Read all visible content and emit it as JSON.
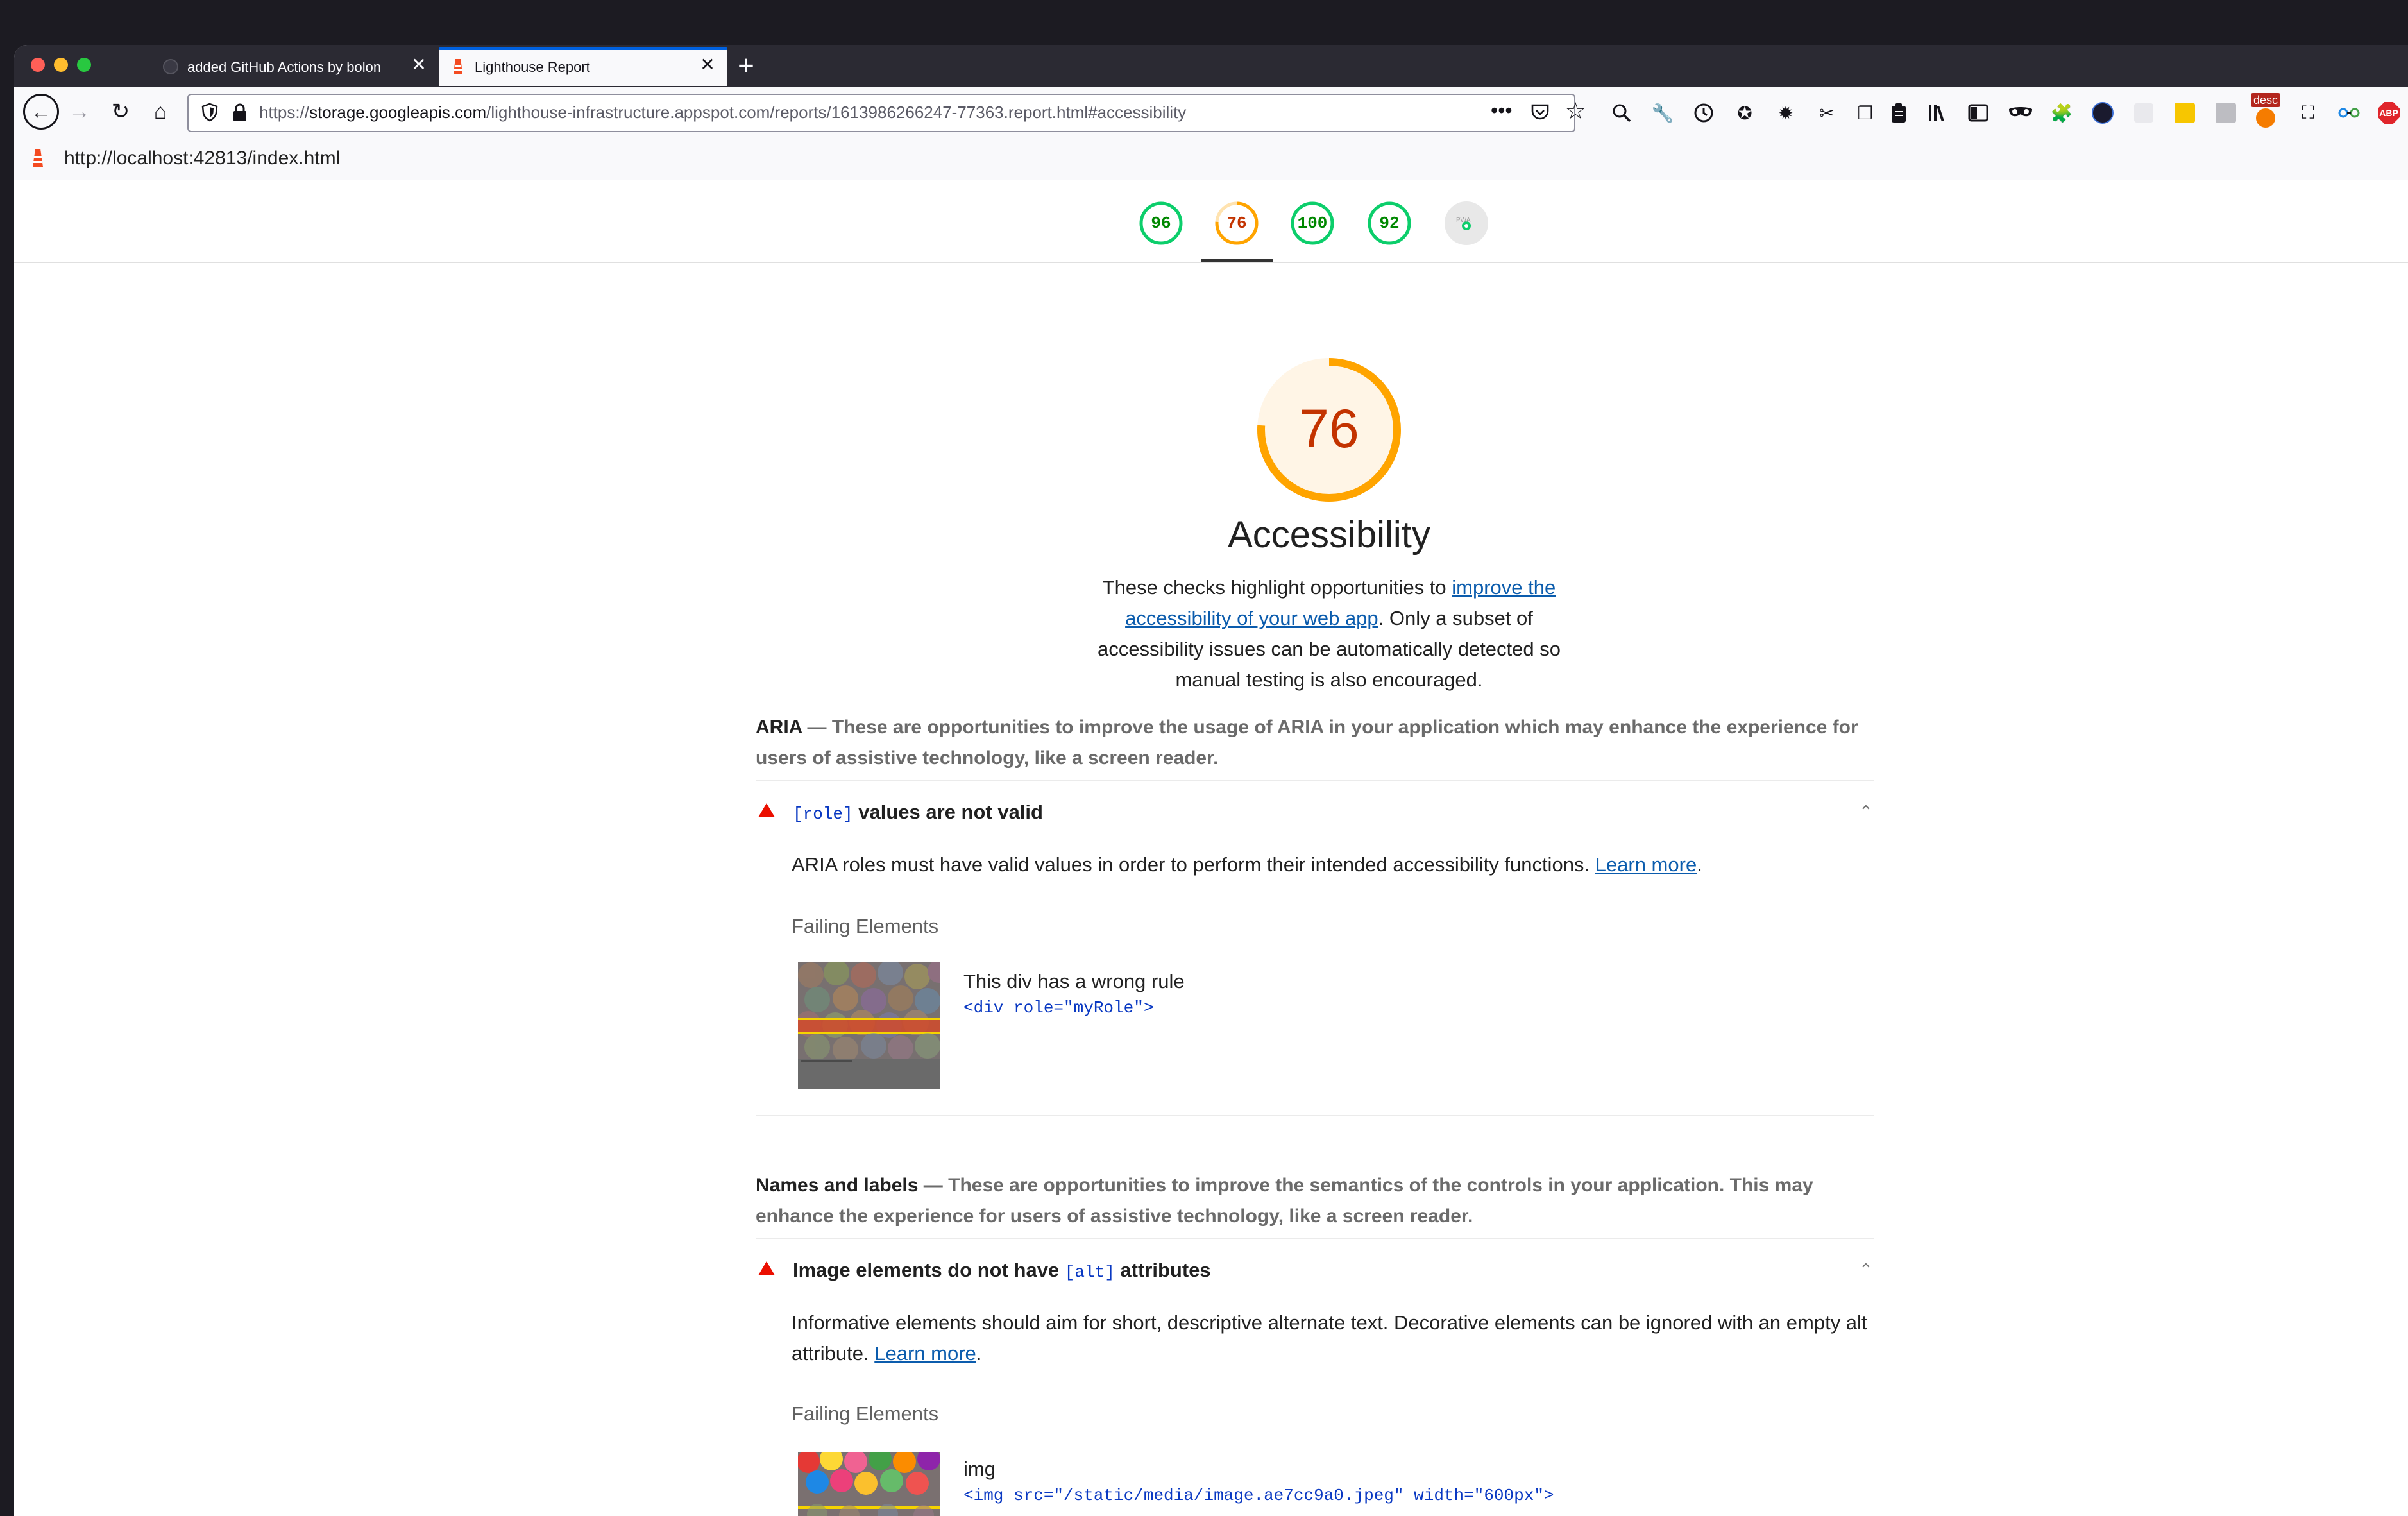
{
  "browser": {
    "tabs": [
      {
        "title": "added GitHub Actions by bolon",
        "active": false
      },
      {
        "title": "Lighthouse Report",
        "active": true
      }
    ],
    "new_tab_label": "+",
    "url": {
      "protocol": "https://",
      "host": "storage.googleapis.com",
      "path": "/lighthouse-infrastructure.appspot.com/reports/1613986266247-77363.report.html#accessibility"
    },
    "toolbar_icons": [
      "page-actions-icon",
      "pocket-icon",
      "bookmark-star-icon",
      "search-icon",
      "wrench-icon",
      "history-icon",
      "reader-icon",
      "settings-icon",
      "scissors-icon",
      "copy-icon",
      "clipboard-icon",
      "library-icon",
      "sidebar-icon",
      "mask-icon",
      "extensions-icon",
      "avatar-icon",
      "blank-extension-icon",
      "yellow-extension-icon",
      "gray-extension-icon",
      "desc-extension-icon",
      "crop-icon",
      "glasses-icon",
      "abp-icon"
    ],
    "desc_badge": "desc",
    "abp_badge": "ABP"
  },
  "infobar": {
    "url": "http://localhost:42813/index.html"
  },
  "scores": [
    {
      "value": "96",
      "level": "pass",
      "color": "#0cce6b"
    },
    {
      "value": "76",
      "level": "average",
      "color": "#ffa400",
      "selected": true
    },
    {
      "value": "100",
      "level": "pass",
      "color": "#0cce6b"
    },
    {
      "value": "92",
      "level": "pass",
      "color": "#0cce6b"
    },
    {
      "value": "",
      "level": "pwa",
      "color": "#9e9e9e"
    }
  ],
  "pwa_label": "PWA",
  "category": {
    "score": "76",
    "score_fraction": 0.76,
    "title": "Accessibility",
    "desc_before": "These checks highlight opportunities to ",
    "desc_link": "improve the accessibility of your web app",
    "desc_after": ". Only a subset of accessibility issues can be automatically detected so manual testing is also encouraged."
  },
  "groups": [
    {
      "title": "ARIA",
      "separator": " — ",
      "description": "These are opportunities to improve the usage of ARIA in your application which may enhance the experience for users of assistive technology, like a screen reader.",
      "audit": {
        "title_code": "[role]",
        "title_text": " values are not valid",
        "description": "ARIA roles must have valid values in order to perform their intended accessibility functions. ",
        "learn_more": "Learn more",
        "period": ".",
        "failing_label": "Failing Elements",
        "element_label": "This div has a wrong rule",
        "element_snippet": "<div role=\"myRole\">"
      }
    },
    {
      "title": "Names and labels",
      "separator": " — ",
      "description": "These are opportunities to improve the semantics of the controls in your application. This may enhance the experience for users of assistive technology, like a screen reader.",
      "audit": {
        "title_text_before": "Image elements do not have ",
        "title_code": "[alt]",
        "title_text_after": " attributes",
        "description": "Informative elements should aim for short, descriptive alternate text. Decorative elements can be ignored with an empty alt attribute. ",
        "learn_more": "Learn more",
        "period": ".",
        "failing_label": "Failing Elements",
        "element_label": "img",
        "element_snippet": "<img src=\"/static/media/image.ae7cc9a0.jpeg\" width=\"600px\">"
      }
    }
  ],
  "colors": {
    "fail": "#eb0f00",
    "pass": "#0cce6b",
    "average": "#ffa400",
    "link": "#0b5cad"
  }
}
